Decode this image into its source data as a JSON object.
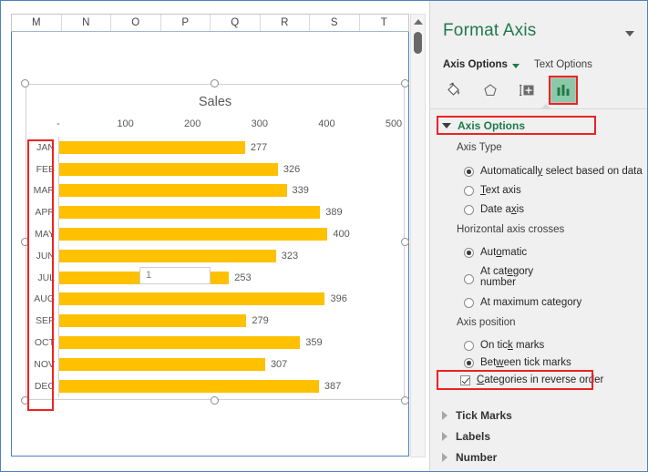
{
  "spreadsheet": {
    "columns": [
      "M",
      "N",
      "O",
      "P",
      "Q",
      "R",
      "S",
      "T"
    ],
    "scrollbar": {
      "up_arrow": "scroll-up-arrow",
      "thumb": "scroll-thumb"
    }
  },
  "chart_data": {
    "type": "bar",
    "orientation": "horizontal",
    "title": "Sales",
    "xlabel": "",
    "ylabel": "",
    "categories": [
      "JAN",
      "FEB",
      "MAR",
      "APR",
      "MAY",
      "JUN",
      "JUL",
      "AUG",
      "SEP",
      "OCT",
      "NOV",
      "DEC"
    ],
    "values": [
      277,
      326,
      339,
      389,
      400,
      323,
      253,
      396,
      279,
      359,
      307,
      387
    ],
    "bar_color": "#FFC000",
    "data_labels": true,
    "grid": false,
    "legend": "none",
    "xlim": [
      0,
      500
    ],
    "xticks": [
      0,
      100,
      200,
      300,
      400,
      500
    ],
    "xtick_labels": [
      "-",
      "100",
      "200",
      "300",
      "400",
      "500"
    ],
    "categories_reversed_display": false
  },
  "panel": {
    "title": "Format Axis",
    "dropdown_icon": "chevron-down-icon",
    "tabs": [
      {
        "label": "Axis Options",
        "active": true
      },
      {
        "label": "Text Options",
        "active": false
      }
    ],
    "icons": [
      {
        "name": "fill-icon",
        "glyph": "fill",
        "selected": false
      },
      {
        "name": "effects-icon",
        "glyph": "pentagon",
        "selected": false
      },
      {
        "name": "size-properties-icon",
        "glyph": "size",
        "selected": false
      },
      {
        "name": "axis-options-chart-icon",
        "glyph": "bar-chart",
        "selected": true
      }
    ],
    "section": {
      "label": "Axis Options",
      "expanded": true,
      "groups": [
        {
          "label": "Axis Type",
          "type": "radio",
          "options": [
            {
              "label": "Automatically select based on data",
              "accel": "y",
              "selected": true
            },
            {
              "label": "Text axis",
              "accel": "T",
              "selected": false
            },
            {
              "label": "Date axis",
              "accel": "x",
              "selected": false
            }
          ]
        },
        {
          "label": "Horizontal axis crosses",
          "type": "radio",
          "options": [
            {
              "label": "Automatic",
              "accel": "o",
              "selected": true
            },
            {
              "label": "At category number",
              "accel": "e",
              "selected": false,
              "input_value": "1"
            },
            {
              "label": "At maximum category",
              "accel": "g",
              "selected": false
            }
          ]
        },
        {
          "label": "Axis position",
          "type": "radio",
          "options": [
            {
              "label": "On tick marks",
              "accel": "k",
              "selected": false
            },
            {
              "label": "Between tick marks",
              "accel": "w",
              "selected": true
            }
          ]
        }
      ],
      "checkbox": {
        "label": "Categories in reverse order",
        "accel": "C",
        "checked": true
      }
    },
    "collapsed_sections": [
      {
        "label": "Tick Marks"
      },
      {
        "label": "Labels"
      },
      {
        "label": "Number"
      }
    ]
  },
  "annotations": {
    "highlight_color": "#EE2222",
    "boxes": [
      {
        "name": "category-labels-highlight"
      },
      {
        "name": "axis-options-header-highlight"
      },
      {
        "name": "chart-icon-highlight"
      },
      {
        "name": "reverse-order-highlight"
      }
    ]
  }
}
